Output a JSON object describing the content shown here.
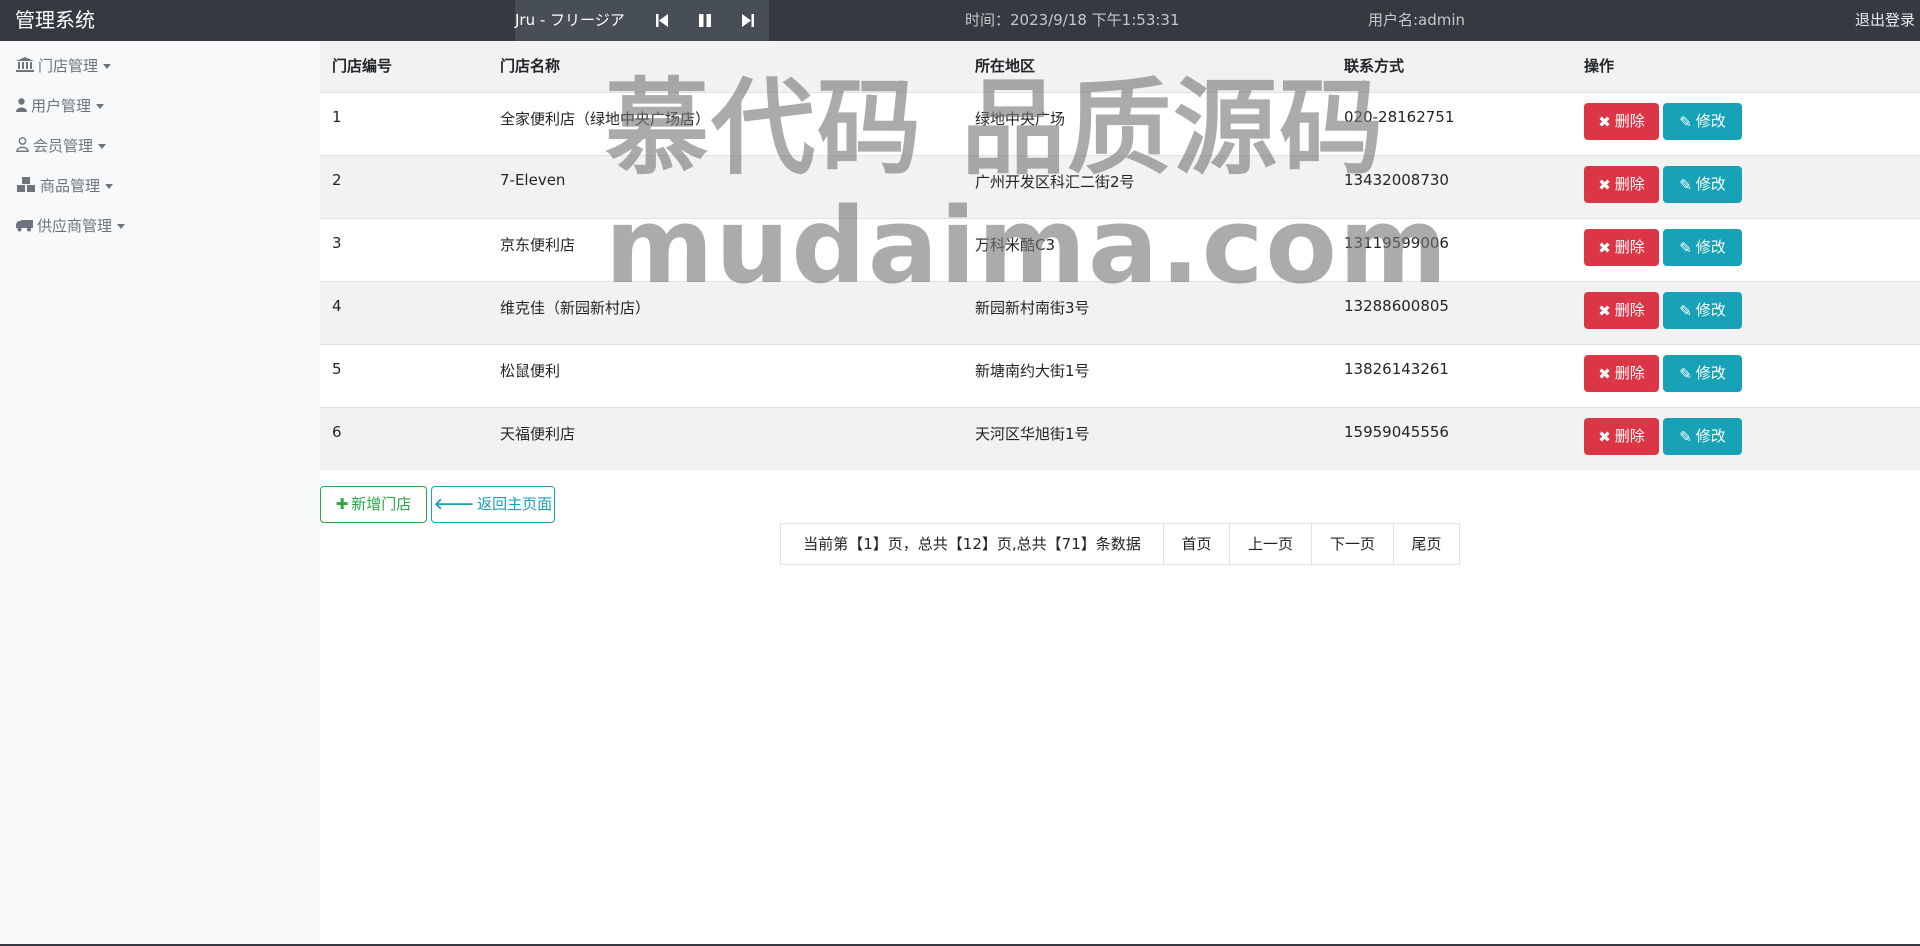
{
  "navbar": {
    "brand": "管理系统",
    "player": {
      "song": "Jru - フリージア",
      "prev_icon": "skip-back-icon",
      "pause_icon": "pause-icon",
      "next_icon": "skip-forward-icon"
    },
    "time": "时间：2023/9/18 下午1:53:31",
    "user": "用户名:admin",
    "logout": "退出登录"
  },
  "sidebar": {
    "items": [
      {
        "label": "门店管理",
        "icon": "bank-icon"
      },
      {
        "label": "用户管理",
        "icon": "user-icon"
      },
      {
        "label": "会员管理",
        "icon": "user-outline-icon"
      },
      {
        "label": "商品管理",
        "icon": "cubes-icon"
      },
      {
        "label": "供应商管理",
        "icon": "truck-icon"
      }
    ]
  },
  "table": {
    "headers": [
      "门店编号",
      "门店名称",
      "所在地区",
      "联系方式",
      "操作"
    ],
    "rows": [
      {
        "id": "1",
        "name": "全家便利店（绿地中央广场店）",
        "region": "绿地中央广场",
        "phone": "020-28162751"
      },
      {
        "id": "2",
        "name": "7-Eleven",
        "region": "广州开发区科汇二街2号",
        "phone": "13432008730"
      },
      {
        "id": "3",
        "name": "京东便利店",
        "region": "万科米酷C3",
        "phone": "13119599006"
      },
      {
        "id": "4",
        "name": "维克佳（新园新村店）",
        "region": "新园新村南街3号",
        "phone": "13288600805"
      },
      {
        "id": "5",
        "name": "松鼠便利",
        "region": "新塘南约大街1号",
        "phone": "13826143261"
      },
      {
        "id": "6",
        "name": "天福便利店",
        "region": "天河区华旭街1号",
        "phone": "15959045556"
      }
    ],
    "delete_label": "删除",
    "edit_label": "修改"
  },
  "actions": {
    "add_label": "新增门店",
    "back_label": "返回主页面"
  },
  "pagination": {
    "info": "当前第【1】页，总共【12】页,总共【71】条数据",
    "first": "首页",
    "prev": "上一页",
    "next": "下一页",
    "last": "尾页"
  },
  "watermark": {
    "line1": "慕代码 品质源码",
    "line2": "mudaima.com"
  }
}
